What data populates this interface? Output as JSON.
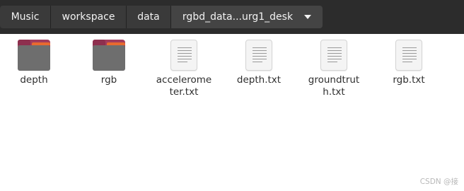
{
  "pathbar": {
    "segments": [
      "Music",
      "workspace",
      "data",
      "rgbd_data...urg1_desk"
    ]
  },
  "files": [
    {
      "name": "depth",
      "type": "folder"
    },
    {
      "name": "rgb",
      "type": "folder"
    },
    {
      "name": "accelerome\nter.txt",
      "type": "text-file"
    },
    {
      "name": "depth.txt",
      "type": "text-file"
    },
    {
      "name": "groundtrut\nh.txt",
      "type": "text-file"
    },
    {
      "name": "rgb.txt",
      "type": "text-file"
    }
  ],
  "watermark": "CSDN @接",
  "colors": {
    "header_bg": "#2c2c2c",
    "crumb_bg": "#3a3a3a",
    "folder_front": "#6e6e6e",
    "folder_back": "#a33c5c",
    "folder_accent": "#e86a2f"
  }
}
